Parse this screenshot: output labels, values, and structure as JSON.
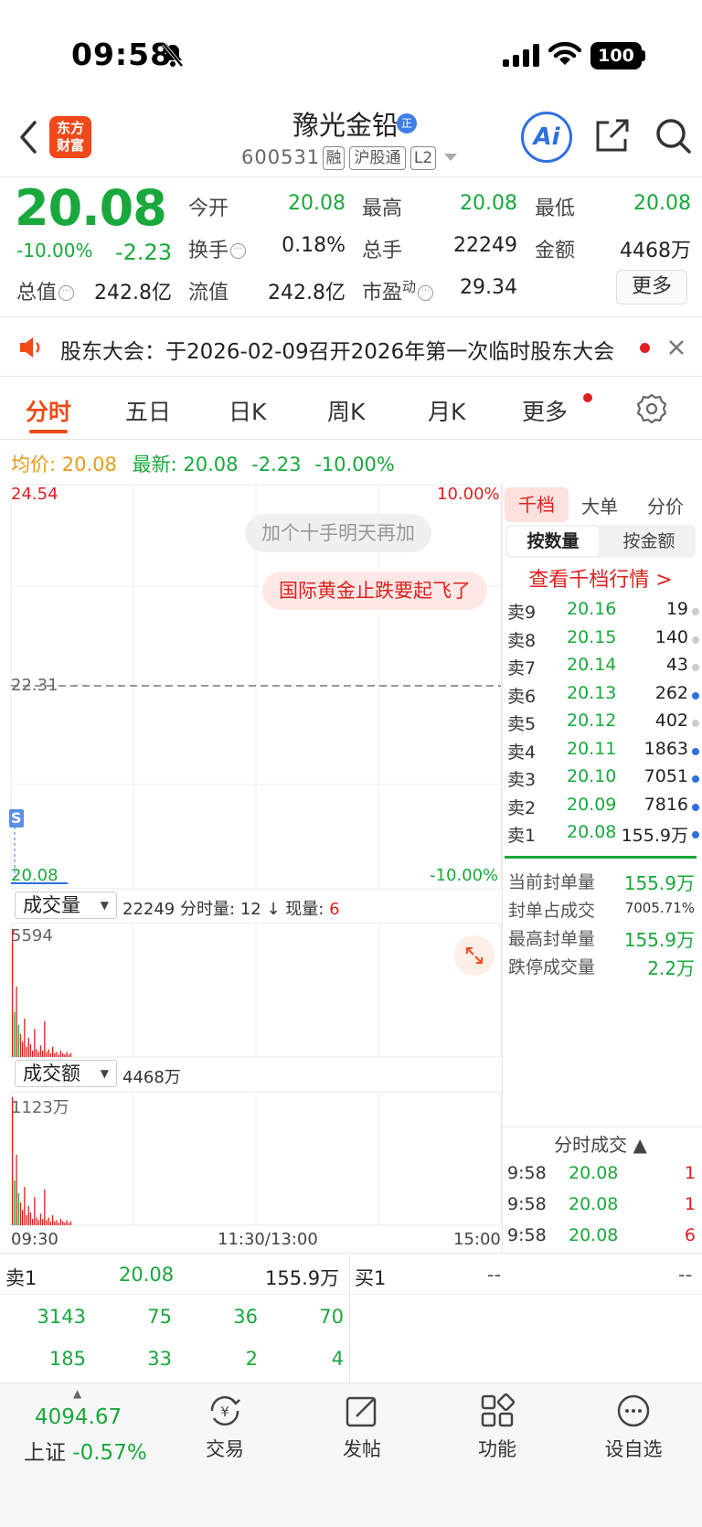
{
  "status_bar": {
    "time": "09:58",
    "battery": "100"
  },
  "header": {
    "app_logo": "东方\n财富",
    "stock_name": "豫光金铅",
    "zheng_badge": "正",
    "stock_code": "600531",
    "tags": [
      "融",
      "沪股通",
      "L2"
    ],
    "ai_label": "Ai"
  },
  "quote": {
    "price": "20.08",
    "change_pct": "-10.00%",
    "change": "-2.23",
    "fields": [
      {
        "label": "今开",
        "value": "20.08",
        "color": "green"
      },
      {
        "label": "最高",
        "value": "20.08",
        "color": "green"
      },
      {
        "label": "最低",
        "value": "20.08",
        "color": "green"
      },
      {
        "label": "换手",
        "value": "0.18%",
        "color": "dark"
      },
      {
        "label": "总手",
        "value": "22249",
        "color": "dark"
      },
      {
        "label": "金额",
        "value": "4468万",
        "color": "dark"
      },
      {
        "label": "总值",
        "value": "242.8亿",
        "color": "dark"
      },
      {
        "label": "流值",
        "value": "242.8亿",
        "color": "dark"
      },
      {
        "label": "市盈",
        "label_sup": "动",
        "value": "29.34",
        "color": "dark"
      }
    ],
    "more_button": "更多"
  },
  "announcement": {
    "text": "股东大会：于2026-02-09召开2026年第一次临时股东大会"
  },
  "tabs": {
    "items": [
      "分时",
      "五日",
      "日K",
      "周K",
      "月K",
      "更多"
    ],
    "active": "分时"
  },
  "avg_line": {
    "avg_label": "均价:",
    "avg_value": "20.08",
    "latest_label": "最新:",
    "latest_value": "20.08",
    "change": "-2.23",
    "pct": "-10.00%"
  },
  "chart": {
    "top_price": "24.54",
    "mid_price": "22.31",
    "bottom_price": "20.08",
    "top_pct": "10.00%",
    "bottom_pct": "-10.00%",
    "marker": "S",
    "annotation_gray": "加个十手明天再加",
    "annotation_red": "国际黄金止跌要起飞了",
    "volume_selector": "成交量",
    "volume_info_total": "22249",
    "volume_info_label1": "分时量:",
    "volume_info_val1": "12",
    "volume_info_label2": "现量:",
    "volume_info_val2": "6",
    "volume_max": "5594",
    "amount_selector": "成交额",
    "amount_total": "4468万",
    "amount_max": "1123万",
    "time_start": "09:30",
    "time_mid": "11:30/13:00",
    "time_end": "15:00"
  },
  "order_book": {
    "tabs": [
      "千档",
      "大单",
      "分价"
    ],
    "seg": [
      "按数量",
      "按金额"
    ],
    "view_link": "查看千档行情 >",
    "asks": [
      {
        "label": "卖9",
        "price": "20.16",
        "vol": "19",
        "dot": "#cccccc"
      },
      {
        "label": "卖8",
        "price": "20.15",
        "vol": "140",
        "dot": "#cccccc"
      },
      {
        "label": "卖7",
        "price": "20.14",
        "vol": "43",
        "dot": "#cccccc"
      },
      {
        "label": "卖6",
        "price": "20.13",
        "vol": "262",
        "dot": "#2f6fdf"
      },
      {
        "label": "卖5",
        "price": "20.12",
        "vol": "402",
        "dot": "#cccccc"
      },
      {
        "label": "卖4",
        "price": "20.11",
        "vol": "1863",
        "dot": "#2f6fdf"
      },
      {
        "label": "卖3",
        "price": "20.10",
        "vol": "7051",
        "dot": "#2f6fdf"
      },
      {
        "label": "卖2",
        "price": "20.09",
        "vol": "7816",
        "dot": "#2f6fdf"
      },
      {
        "label": "卖1",
        "price": "20.08",
        "vol": "155.9万",
        "dot": "#2f6fdf"
      }
    ],
    "seal_stats": [
      {
        "label": "当前封单量",
        "value": "155.9万"
      },
      {
        "label": "封单占成交",
        "value": "7005.71%"
      },
      {
        "label": "最高封单量",
        "value": "155.9万"
      },
      {
        "label": "跌停成交量",
        "value": "2.2万"
      }
    ],
    "tick_header": "分时成交 ▲",
    "ticks": [
      {
        "time": "9:58",
        "price": "20.08",
        "qty": "1"
      },
      {
        "time": "9:58",
        "price": "20.08",
        "qty": "1"
      },
      {
        "time": "9:58",
        "price": "20.08",
        "qty": "6"
      }
    ]
  },
  "bottom_quote": {
    "sell_label": "卖1",
    "sell_price": "20.08",
    "sell_vol": "155.9万",
    "buy_label": "买1",
    "buy_price": "--",
    "buy_vol": "--",
    "row1": [
      "3143",
      "75",
      "36",
      "70"
    ],
    "row2": [
      "185",
      "33",
      "2",
      "4"
    ]
  },
  "bottom_nav": {
    "index_value": "4094.67",
    "index_name": "上证",
    "index_pct": "-0.57%",
    "items": [
      "交易",
      "发帖",
      "功能",
      "设自选"
    ]
  }
}
